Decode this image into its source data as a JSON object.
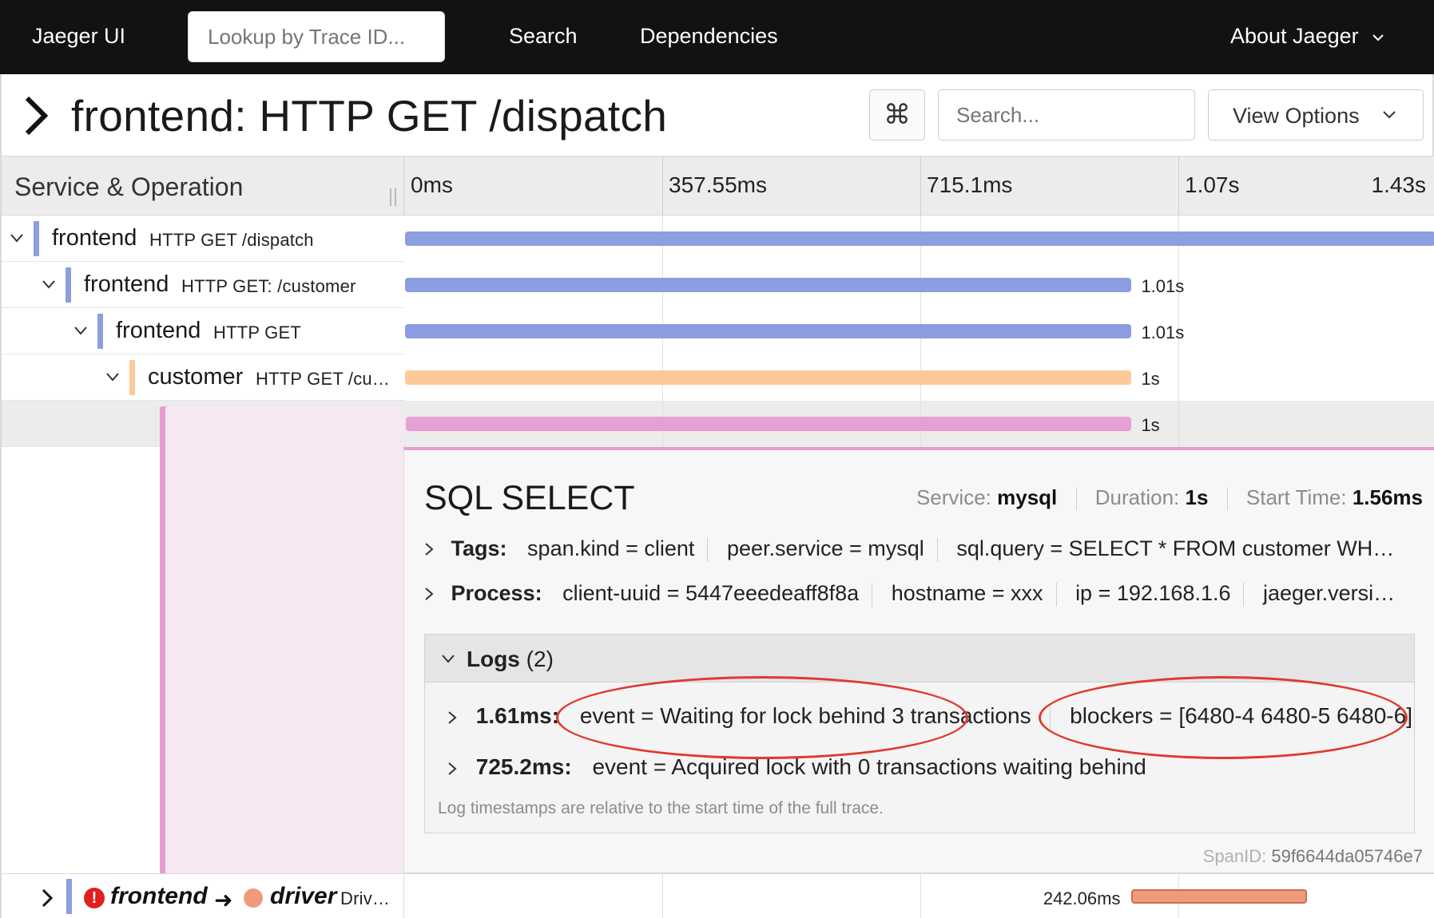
{
  "nav": {
    "brand": "Jaeger UI",
    "lookup_placeholder": "Lookup by Trace ID...",
    "links": [
      "Search",
      "Dependencies"
    ],
    "about": "About Jaeger"
  },
  "trace": {
    "title": "frontend: HTTP GET /dispatch",
    "keyboard_icon": "⌘",
    "search_placeholder": "Search...",
    "view_options": "View Options"
  },
  "timeline": {
    "column_label": "Service & Operation",
    "ticks": [
      "0ms",
      "357.55ms",
      "715.1ms",
      "1.07s",
      "1.43s"
    ]
  },
  "spans": [
    {
      "service": "frontend",
      "operation": "HTTP GET /dispatch",
      "duration": "",
      "color": "#8c9ee0",
      "depth": 0,
      "start": 0.0,
      "end": 1.0
    },
    {
      "service": "frontend",
      "operation": "HTTP GET: /customer",
      "duration": "1.01s",
      "color": "#8c9ee0",
      "depth": 1,
      "start": 0.0,
      "end": 0.705
    },
    {
      "service": "frontend",
      "operation": "HTTP GET",
      "duration": "1.01s",
      "color": "#8c9ee0",
      "depth": 2,
      "start": 0.0,
      "end": 0.705
    },
    {
      "service": "customer",
      "operation": "HTTP GET /cu…",
      "duration": "1s",
      "color": "#fdc999",
      "depth": 3,
      "start": 0.0,
      "end": 0.705
    },
    {
      "service": "mysql",
      "operation": "SQL SELECT",
      "duration": "1s",
      "color": "#e6a0d4",
      "depth": 4,
      "start": 0.001,
      "end": 0.705
    }
  ],
  "detail": {
    "operation": "SQL SELECT",
    "service_label": "Service:",
    "service": "mysql",
    "duration_label": "Duration:",
    "duration": "1s",
    "start_label": "Start Time:",
    "start": "1.56ms",
    "tags_label": "Tags:",
    "tags": [
      "span.kind = client",
      "peer.service = mysql",
      "sql.query = SELECT * FROM customer WH…"
    ],
    "process_label": "Process:",
    "process": [
      "client-uuid = 5447eeedeaff8f8a",
      "hostname = xxx",
      "ip = 192.168.1.6",
      "jaeger.versi…"
    ],
    "logs_label": "Logs",
    "logs_count": "(2)",
    "logs": [
      {
        "time": "1.61ms:",
        "fields": [
          "event = Waiting for lock behind 3 transactions",
          "blockers = [6480-4 6480-5 6480-6]"
        ]
      },
      {
        "time": "725.2ms:",
        "fields": [
          "event = Acquired lock with 0 transactions waiting behind"
        ]
      }
    ],
    "log_note": "Log timestamps are relative to the start time of the full trace.",
    "spanid_label": "SpanID:",
    "spanid": "59f6644da05746e7"
  },
  "bottom_span": {
    "service_from": "frontend",
    "service_to": "driver",
    "operation": "Driv…",
    "duration": "242.06ms",
    "color": "#8c9ee0",
    "bar_color": "#f09a7d",
    "start": 0.705,
    "end": 0.875
  }
}
